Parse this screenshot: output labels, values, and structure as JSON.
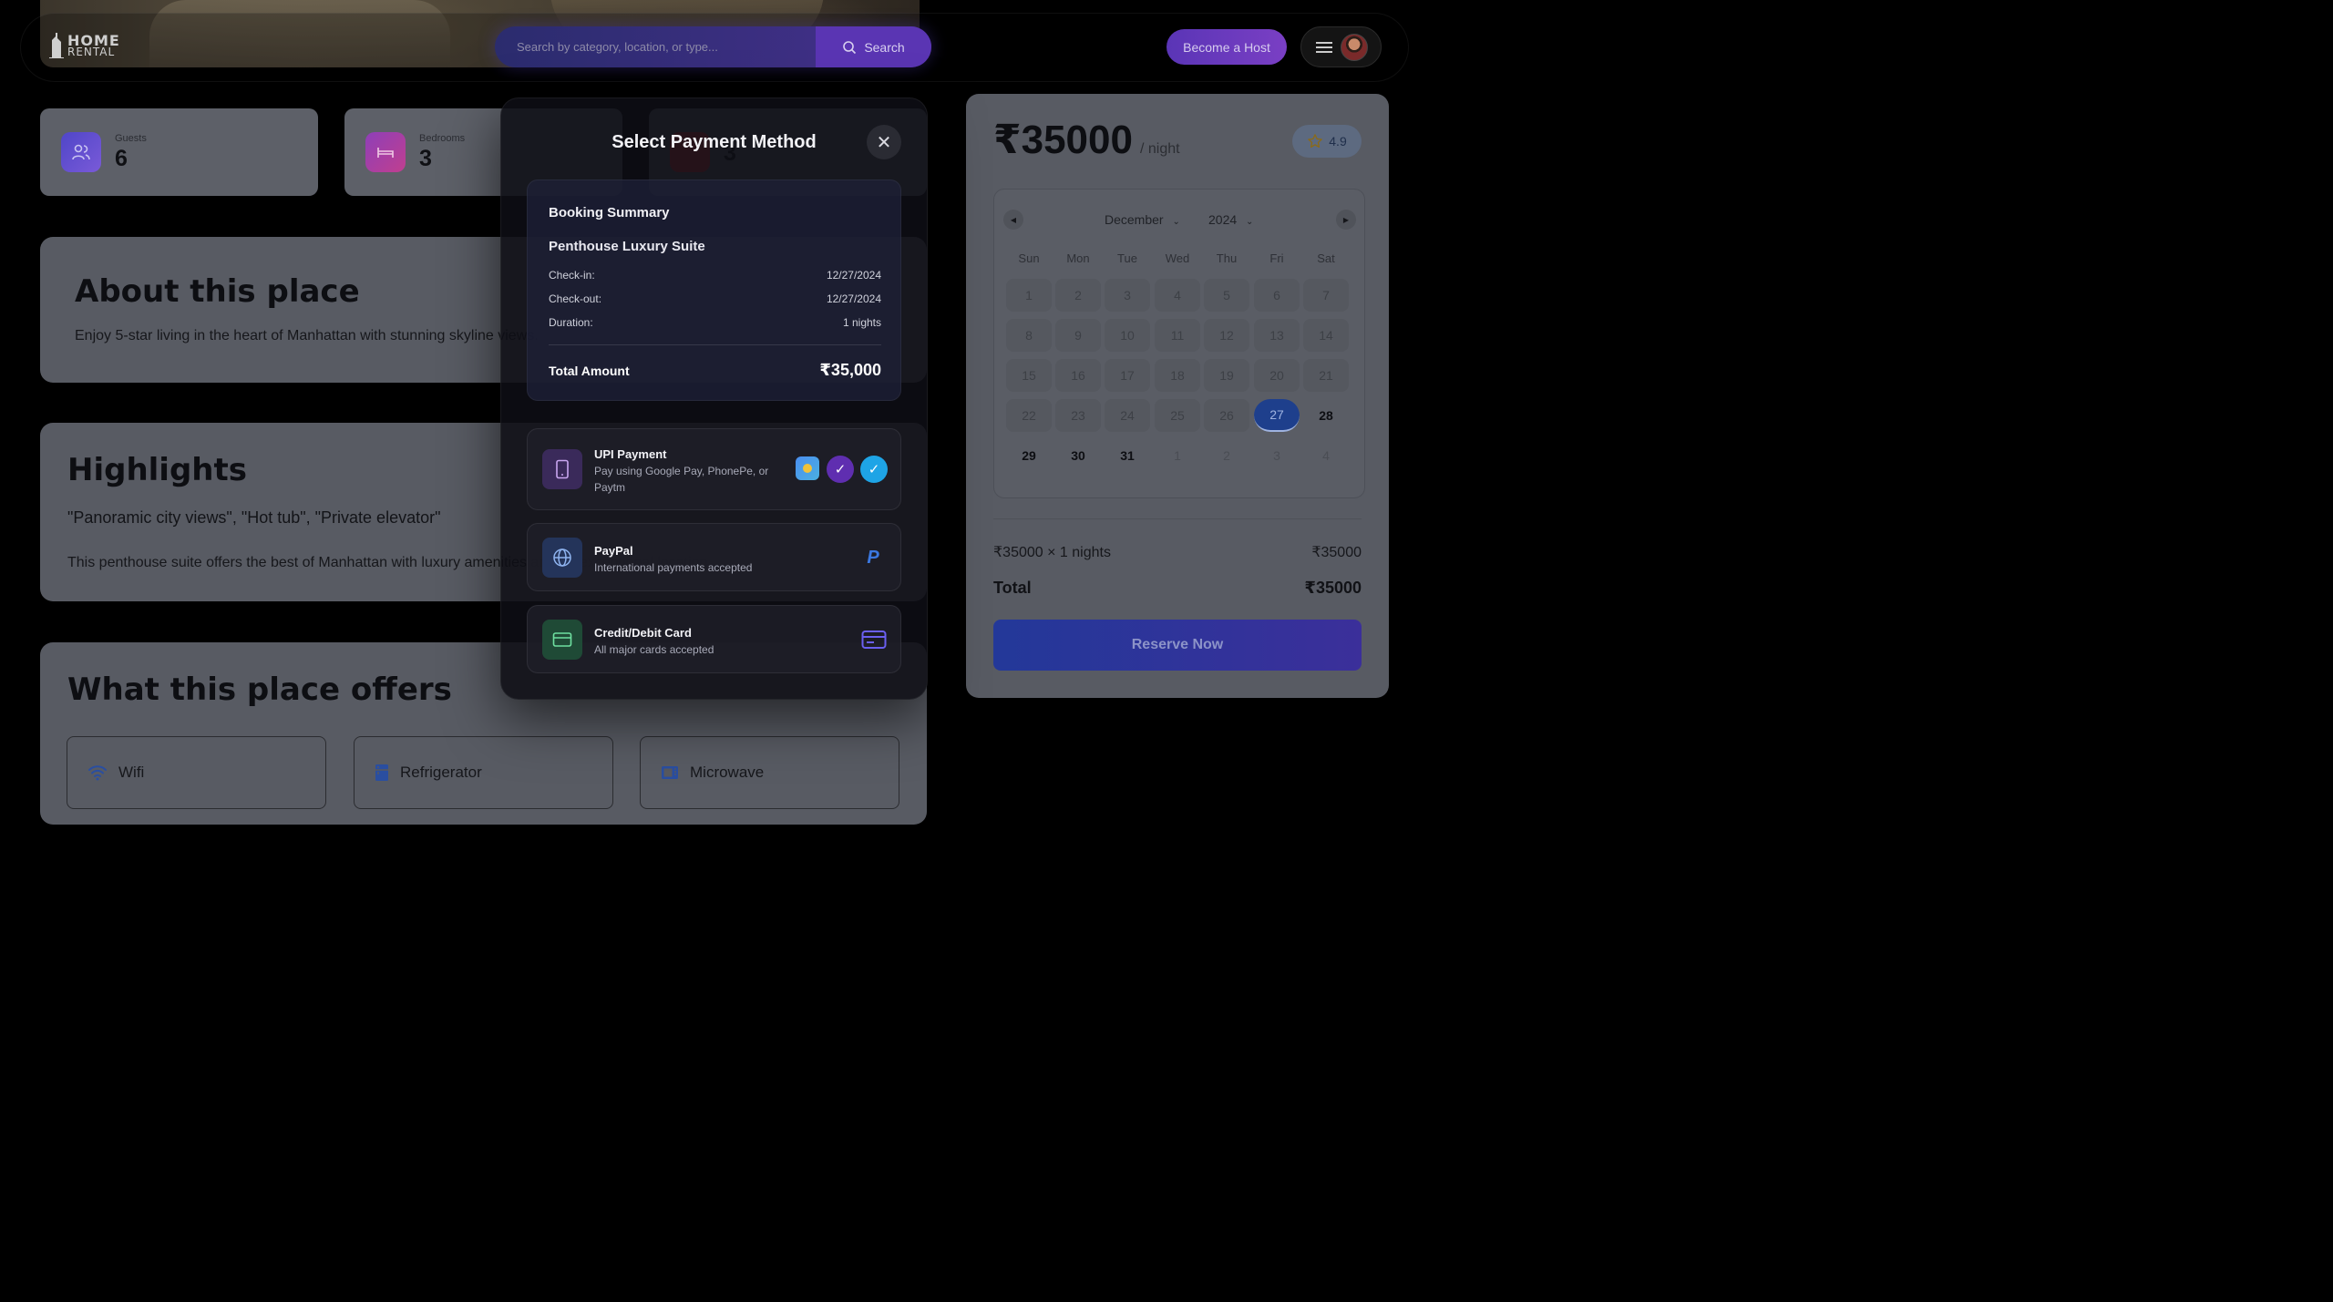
{
  "nav": {
    "logo_line1": "HOME",
    "logo_line2": "RENTAL",
    "search_placeholder": "Search by category, location, or type...",
    "search_label": "Search",
    "host_label": "Become a Host"
  },
  "stats": [
    {
      "label": "Guests",
      "value": "6",
      "color": "#5b4fd6"
    },
    {
      "label": "Bedrooms",
      "value": "3",
      "color": "#b23fa2"
    },
    {
      "label": "",
      "value": "3",
      "color": "#c8313f"
    }
  ],
  "about": {
    "title": "About this place",
    "text": "Enjoy 5-star living in the heart of Manhattan with stunning skyline views."
  },
  "highlights": {
    "title": "Highlights",
    "tags": "\"Panoramic city views\", \"Hot tub\", \"Private elevator\"",
    "text": "This penthouse suite offers the best of Manhattan with luxury amenities and an exceptional location."
  },
  "offers": {
    "title": "What this place offers",
    "items": [
      {
        "label": "Wifi",
        "icon": "wifi-icon"
      },
      {
        "label": "Refrigerator",
        "icon": "refrigerator-icon"
      },
      {
        "label": "Microwave",
        "icon": "microwave-icon"
      }
    ]
  },
  "booking": {
    "price": "₹35000",
    "per": "/ night",
    "rating": "4.9",
    "calendar": {
      "month": "December",
      "year": "2024",
      "weekdays": [
        "Sun",
        "Mon",
        "Tue",
        "Wed",
        "Thu",
        "Fri",
        "Sat"
      ],
      "selected_day": "27",
      "weeks": [
        [
          "1",
          "2",
          "3",
          "4",
          "5",
          "6",
          "7"
        ],
        [
          "8",
          "9",
          "10",
          "11",
          "12",
          "13",
          "14"
        ],
        [
          "15",
          "16",
          "17",
          "18",
          "19",
          "20",
          "21"
        ],
        [
          "22",
          "23",
          "24",
          "25",
          "26",
          "27",
          "28"
        ],
        [
          "29",
          "30",
          "31",
          "1",
          "2",
          "3",
          "4"
        ]
      ]
    },
    "calc_label": "₹35000 × 1 nights",
    "calc_value": "₹35000",
    "total_label": "Total",
    "total_value": "₹35000",
    "reserve_label": "Reserve Now",
    "accent": "#1e3f8c"
  },
  "modal": {
    "title": "Select Payment Method",
    "summary": {
      "heading": "Booking Summary",
      "property": "Penthouse Luxury Suite",
      "rows": [
        {
          "k": "Check-in:",
          "v": "12/27/2024"
        },
        {
          "k": "Check-out:",
          "v": "12/27/2024"
        },
        {
          "k": "Duration:",
          "v": "1 nights"
        }
      ],
      "total_label": "Total Amount",
      "total_value": "₹35,000"
    },
    "methods": [
      {
        "title": "UPI Payment",
        "desc": "Pay using Google Pay, PhonePe, or Paytm",
        "icon": "phone-icon"
      },
      {
        "title": "PayPal",
        "desc": "International payments accepted",
        "icon": "globe-icon"
      },
      {
        "title": "Credit/Debit Card",
        "desc": "All major cards accepted",
        "icon": "card-icon"
      }
    ]
  }
}
